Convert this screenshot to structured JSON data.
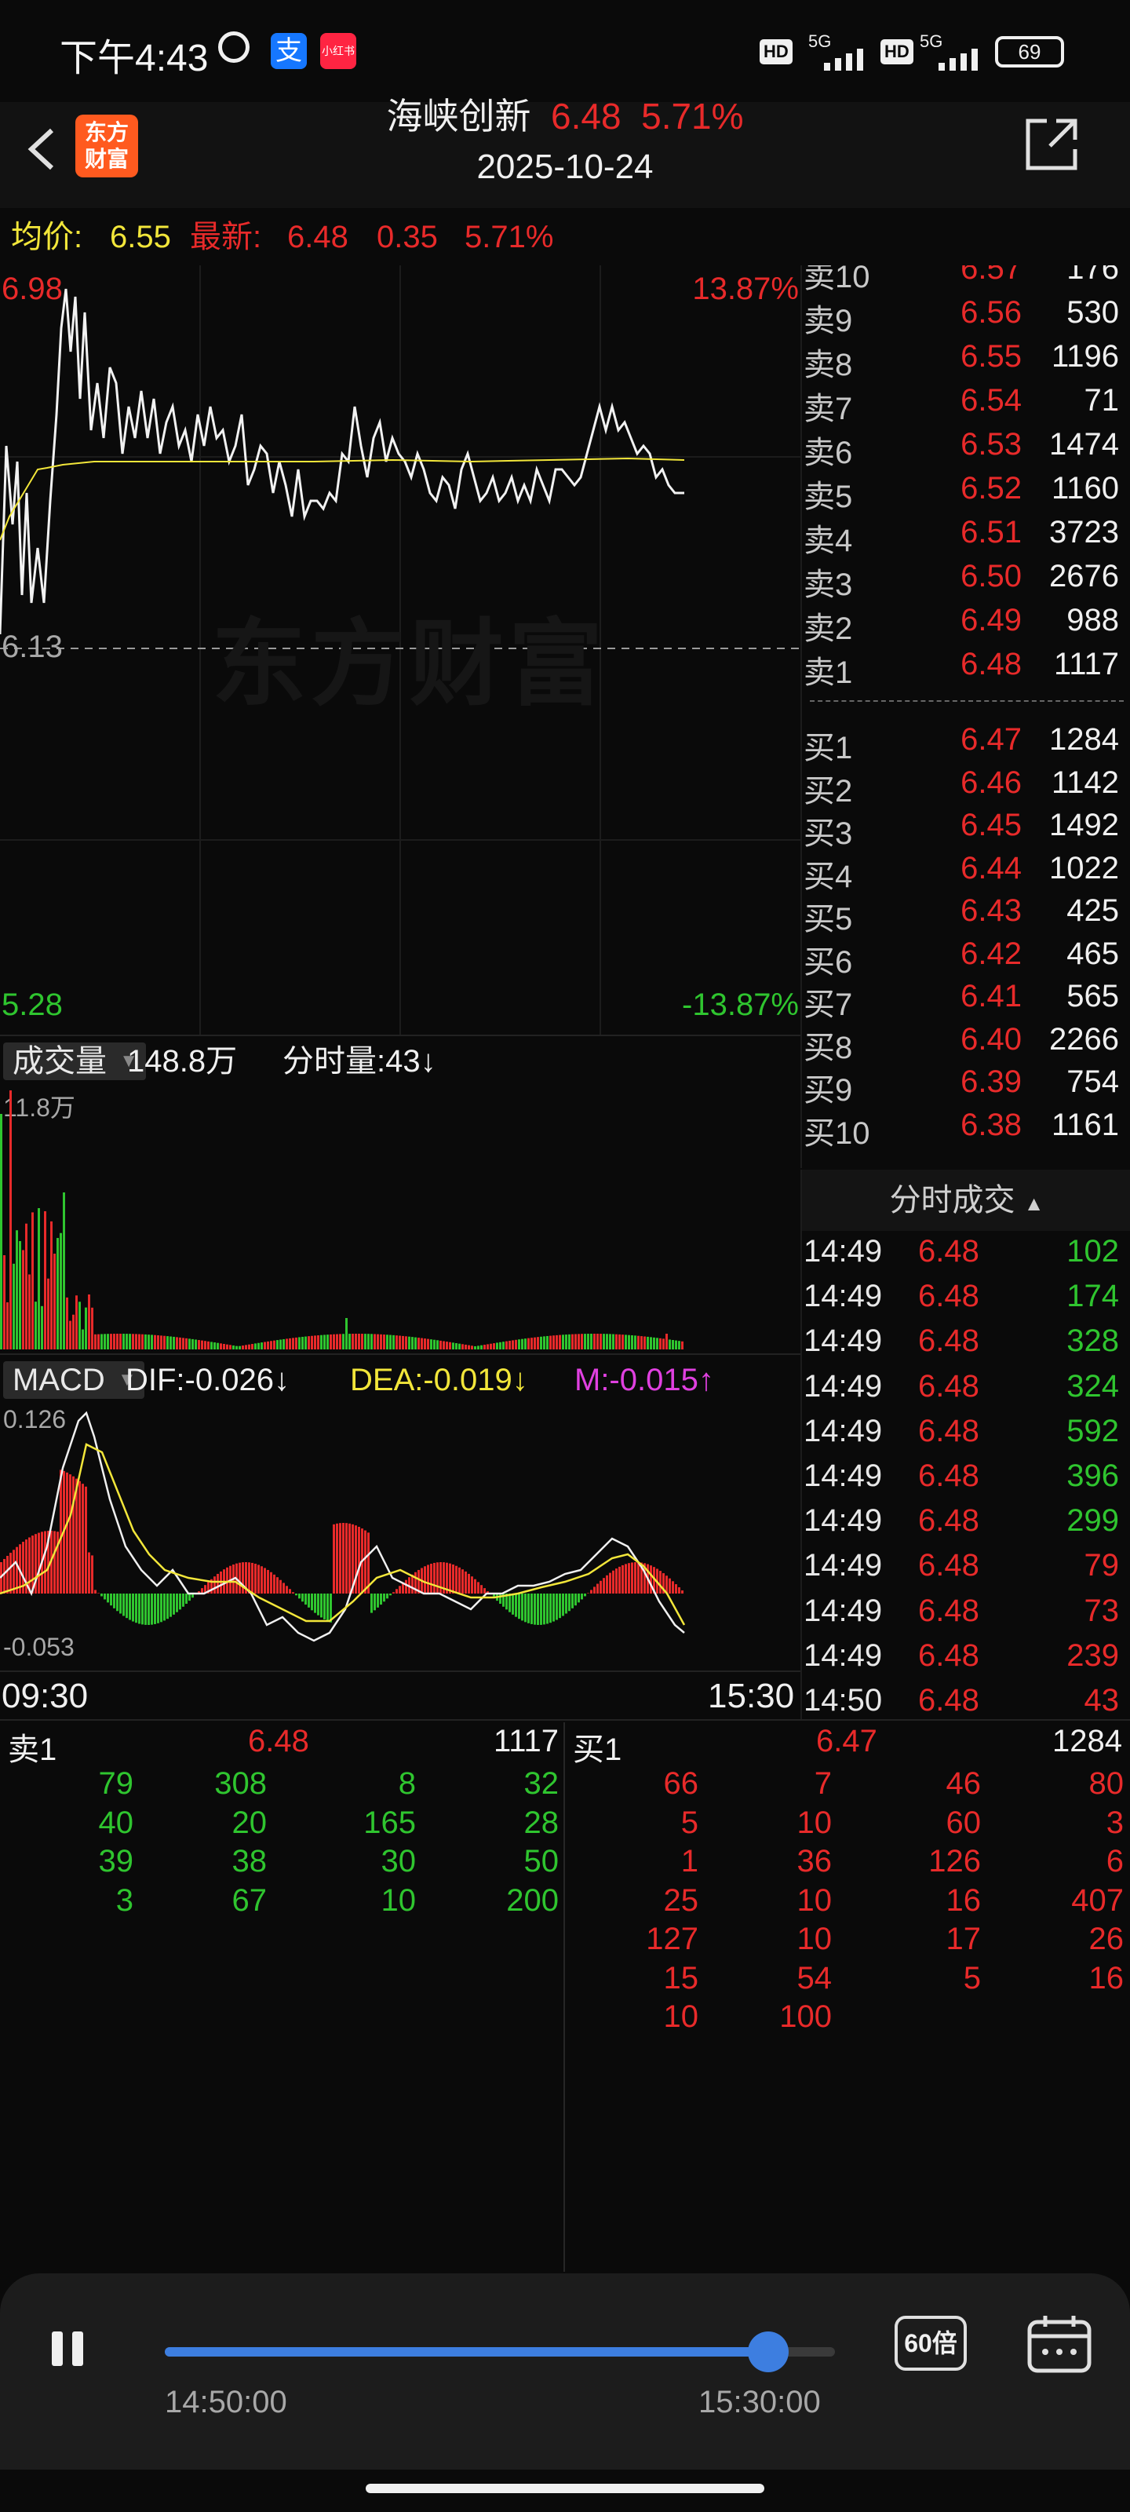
{
  "status_bar": {
    "time": "下午4:43",
    "miniapp": "小红书",
    "network1": "5G",
    "network2": "5G",
    "battery": "69"
  },
  "header": {
    "logo_line1": "东方",
    "logo_line2": "财富",
    "stock_name": "海峡创新",
    "price": "6.48",
    "change_pct": "5.71%",
    "date": "2025-10-24"
  },
  "info_bar": {
    "avg_label": "均价:",
    "avg_value": "6.55",
    "latest_label": "最新:",
    "latest_value": "6.48",
    "change": "0.35",
    "change_pct": "5.71%"
  },
  "price_chart": {
    "high": "6.98",
    "high_pct": "13.87%",
    "prev_close": "6.13",
    "low": "5.28",
    "low_pct": "-13.87%",
    "watermark": "东方财富"
  },
  "volume": {
    "selector": "成交量",
    "total": "148.8万",
    "minute_label": "分时量:43↓",
    "max_label": "11.8万"
  },
  "macd": {
    "selector": "MACD",
    "dif": "DIF:-0.026↓",
    "dea": "DEA:-0.019↓",
    "m": "M:-0.015↑",
    "max_label": "0.126",
    "min_label": "-0.053"
  },
  "time_axis": {
    "start": "09:30",
    "end": "15:30"
  },
  "order_book": {
    "asks": [
      {
        "label": "卖10",
        "price": "6.57",
        "volume": "176"
      },
      {
        "label": "卖9",
        "price": "6.56",
        "volume": "530"
      },
      {
        "label": "卖8",
        "price": "6.55",
        "volume": "1196"
      },
      {
        "label": "卖7",
        "price": "6.54",
        "volume": "71"
      },
      {
        "label": "卖6",
        "price": "6.53",
        "volume": "1474"
      },
      {
        "label": "卖5",
        "price": "6.52",
        "volume": "1160"
      },
      {
        "label": "卖4",
        "price": "6.51",
        "volume": "3723"
      },
      {
        "label": "卖3",
        "price": "6.50",
        "volume": "2676"
      },
      {
        "label": "卖2",
        "price": "6.49",
        "volume": "988"
      },
      {
        "label": "卖1",
        "price": "6.48",
        "volume": "1117"
      }
    ],
    "bids": [
      {
        "label": "买1",
        "price": "6.47",
        "volume": "1284"
      },
      {
        "label": "买2",
        "price": "6.46",
        "volume": "1142"
      },
      {
        "label": "买3",
        "price": "6.45",
        "volume": "1492"
      },
      {
        "label": "买4",
        "price": "6.44",
        "volume": "1022"
      },
      {
        "label": "买5",
        "price": "6.43",
        "volume": "425"
      },
      {
        "label": "买6",
        "price": "6.42",
        "volume": "465"
      },
      {
        "label": "买7",
        "price": "6.41",
        "volume": "565"
      },
      {
        "label": "买8",
        "price": "6.40",
        "volume": "2266"
      },
      {
        "label": "买9",
        "price": "6.39",
        "volume": "754"
      },
      {
        "label": "买10",
        "price": "6.38",
        "volume": "1161"
      }
    ]
  },
  "ticks": {
    "title": "分时成交",
    "rows": [
      {
        "time": "14:49",
        "price": "6.48",
        "volume": "102",
        "dir": "green"
      },
      {
        "time": "14:49",
        "price": "6.48",
        "volume": "174",
        "dir": "green"
      },
      {
        "time": "14:49",
        "price": "6.48",
        "volume": "328",
        "dir": "green"
      },
      {
        "time": "14:49",
        "price": "6.48",
        "volume": "324",
        "dir": "green"
      },
      {
        "time": "14:49",
        "price": "6.48",
        "volume": "592",
        "dir": "green"
      },
      {
        "time": "14:49",
        "price": "6.48",
        "volume": "396",
        "dir": "green"
      },
      {
        "time": "14:49",
        "price": "6.48",
        "volume": "299",
        "dir": "green"
      },
      {
        "time": "14:49",
        "price": "6.48",
        "volume": "79",
        "dir": "red"
      },
      {
        "time": "14:49",
        "price": "6.48",
        "volume": "73",
        "dir": "red"
      },
      {
        "time": "14:49",
        "price": "6.48",
        "volume": "239",
        "dir": "red"
      },
      {
        "time": "14:50",
        "price": "6.48",
        "volume": "43",
        "dir": "red"
      }
    ]
  },
  "queue": {
    "sell_label": "卖1",
    "sell_price": "6.48",
    "sell_volume": "1117",
    "buy_label": "买1",
    "buy_price": "6.47",
    "buy_volume": "1284",
    "sell_rows": [
      [
        "79",
        "308",
        "8",
        "32"
      ],
      [
        "40",
        "20",
        "165",
        "28"
      ],
      [
        "39",
        "38",
        "30",
        "50"
      ],
      [
        "3",
        "67",
        "10",
        "200"
      ]
    ],
    "buy_rows": [
      [
        "66",
        "7",
        "46",
        "80"
      ],
      [
        "5",
        "10",
        "60",
        "3"
      ],
      [
        "1",
        "36",
        "126",
        "6"
      ],
      [
        "25",
        "10",
        "16",
        "407"
      ],
      [
        "127",
        "10",
        "17",
        "26"
      ],
      [
        "15",
        "54",
        "5",
        "16"
      ],
      [
        "10",
        "100",
        "",
        ""
      ]
    ]
  },
  "playback": {
    "start_time": "14:50:00",
    "end_time": "15:30:00",
    "progress": 0.9,
    "speed": "60倍"
  },
  "colors": {
    "up": "#e82a2a",
    "down": "#2fc52f",
    "avg_line": "#f2e63a",
    "accent": "#3d7ee0"
  }
}
